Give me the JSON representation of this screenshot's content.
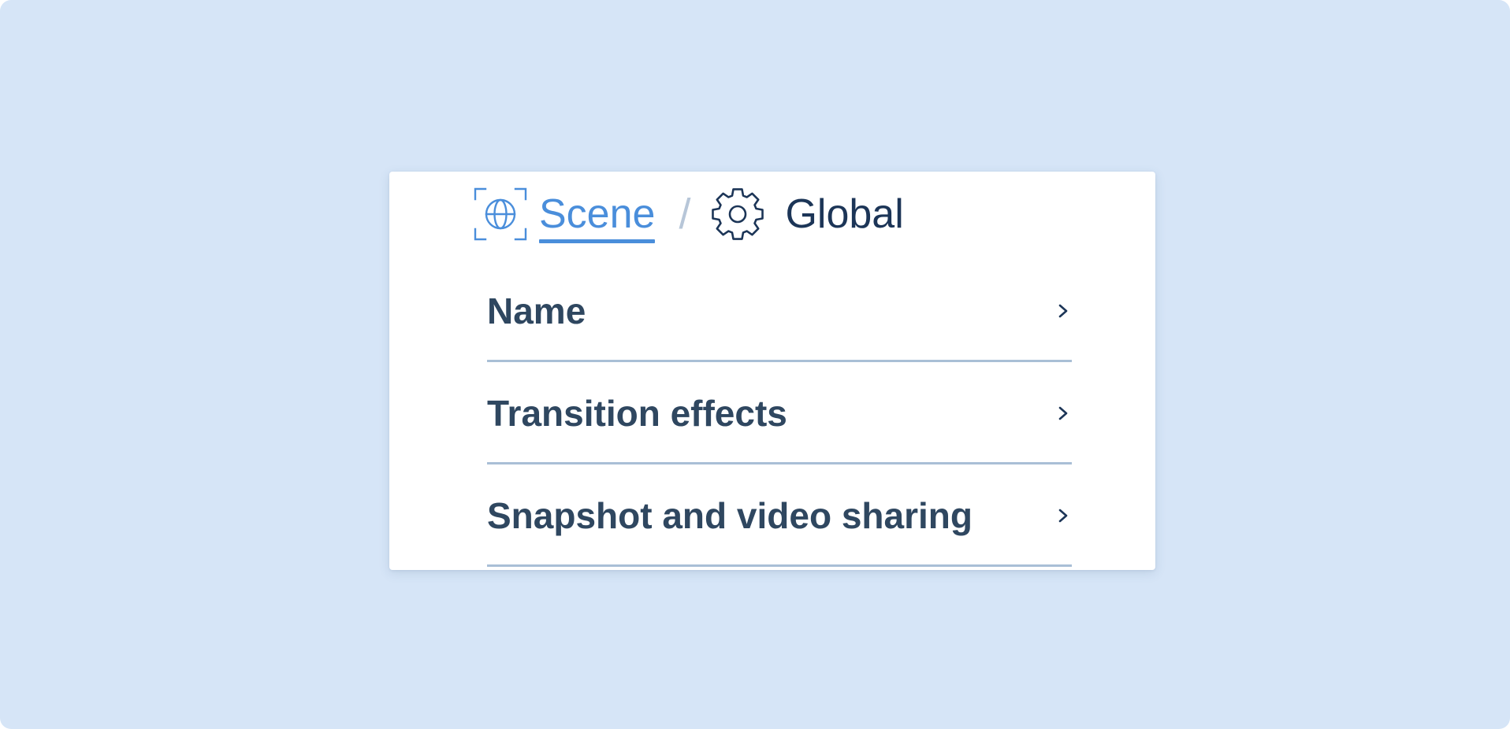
{
  "breadcrumb": {
    "scene_label": "Scene",
    "separator": "/",
    "global_label": "Global",
    "scene_icon": "globe-frame-icon",
    "global_icon": "gear-icon"
  },
  "menu": {
    "items": [
      {
        "label": "Name",
        "icon": "chevron-right-icon"
      },
      {
        "label": "Transition effects",
        "icon": "chevron-right-icon"
      },
      {
        "label": "Snapshot and video sharing",
        "icon": "chevron-right-icon"
      }
    ]
  },
  "colors": {
    "background": "#d6e5f7",
    "panel": "#ffffff",
    "accent": "#4a8edb",
    "title": "#1c3557",
    "text": "#2f4760",
    "divider": "#a9bfd6",
    "separator": "#b7c6d8"
  }
}
